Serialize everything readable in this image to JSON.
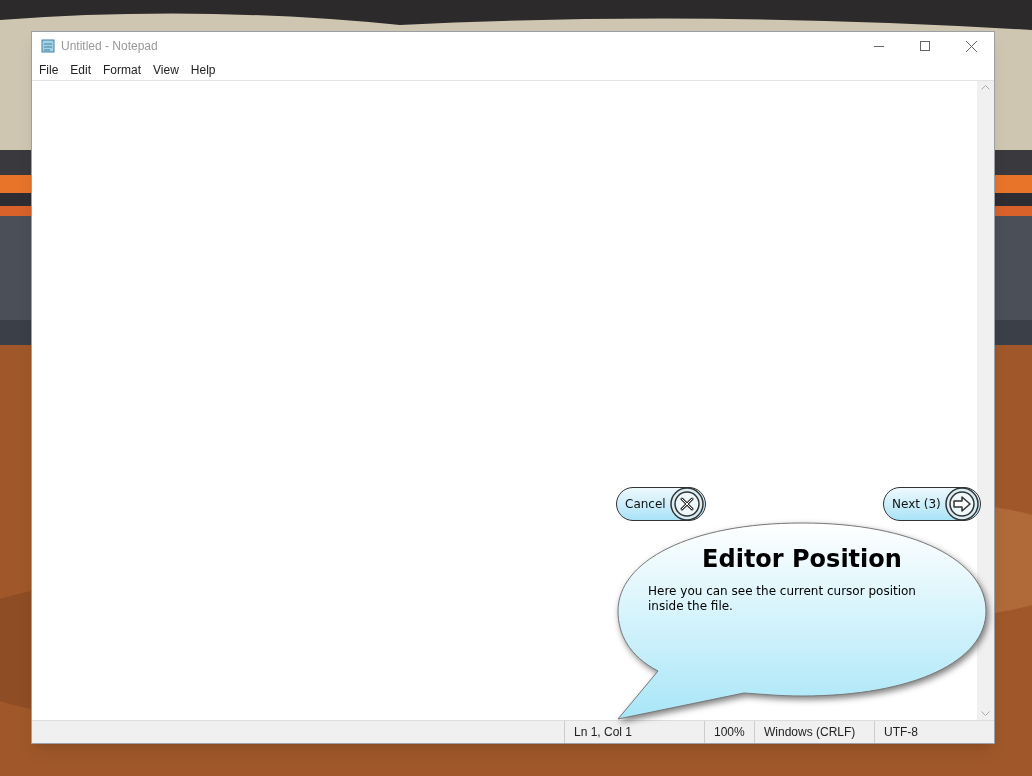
{
  "window": {
    "title": "Untitled - Notepad"
  },
  "menu": [
    "File",
    "Edit",
    "Format",
    "View",
    "Help"
  ],
  "tour": {
    "buttons": [
      {
        "kind": "cancel",
        "label": "Cancel"
      },
      {
        "kind": "next",
        "label": "Next (3)"
      }
    ],
    "balloon": {
      "title": "Editor Position",
      "text": "Here you can see the current cursor position inside the file."
    }
  },
  "status_bar": [
    "Ln 1, Col 1",
    "100%",
    "Windows (CRLF)",
    "UTF-8"
  ]
}
